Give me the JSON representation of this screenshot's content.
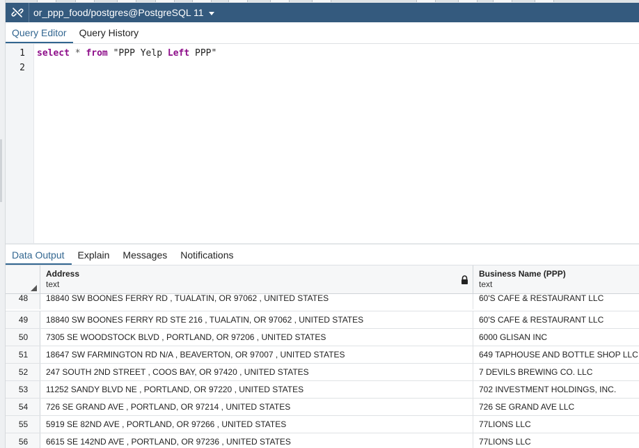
{
  "connection": {
    "label": "or_ppp_food/postgres@PostgreSQL 11"
  },
  "editor_tabs": [
    {
      "label": "Query Editor",
      "active": true
    },
    {
      "label": "Query History",
      "active": false
    }
  ],
  "editor": {
    "line_numbers": [
      "1",
      "2"
    ],
    "query": {
      "kw_select": "select",
      "star": "*",
      "kw_from": "from",
      "str_open": "\"PPP Yelp ",
      "kw_left": "Left",
      "str_close": " PPP\""
    }
  },
  "result_tabs": [
    {
      "label": "Data Output",
      "active": true
    },
    {
      "label": "Explain",
      "active": false
    },
    {
      "label": "Messages",
      "active": false
    },
    {
      "label": "Notifications",
      "active": false
    }
  ],
  "grid": {
    "columns": [
      {
        "name": "Address",
        "type": "text",
        "locked": true
      },
      {
        "name": "Business Name (PPP)",
        "type": "text",
        "locked": false
      }
    ],
    "rows": [
      {
        "n": "48",
        "address": "18840 SW BOONES FERRY RD , TUALATIN, OR 97062 ,  UNITED STATES",
        "business": "60'S CAFE & RESTAURANT LLC"
      },
      {
        "n": "49",
        "address": "18840 SW BOONES FERRY RD STE 216 , TUALATIN, OR 97062 ,  UNITED STATES",
        "business": "60'S CAFE & RESTAURANT LLC"
      },
      {
        "n": "50",
        "address": "7305 SE WOODSTOCK BLVD , PORTLAND, OR 97206 ,  UNITED STATES",
        "business": "6000 GLISAN INC"
      },
      {
        "n": "51",
        "address": "18647 SW FARMINGTON RD N/A , BEAVERTON, OR 97007 ,  UNITED STATES",
        "business": "649 TAPHOUSE AND BOTTLE SHOP LLC"
      },
      {
        "n": "52",
        "address": "247 SOUTH 2ND STREET , COOS BAY, OR 97420 ,  UNITED STATES",
        "business": "7 DEVILS BREWING CO. LLC"
      },
      {
        "n": "53",
        "address": "11252 SANDY BLVD NE , PORTLAND, OR 97220 ,  UNITED STATES",
        "business": "702 INVESTMENT HOLDINGS, INC."
      },
      {
        "n": "54",
        "address": "726 SE GRAND AVE , PORTLAND, OR 97214 ,  UNITED STATES",
        "business": "726 SE GRAND AVE LLC"
      },
      {
        "n": "55",
        "address": "5919 SE 82ND AVE , PORTLAND, OR 97266 ,  UNITED STATES",
        "business": "77LIONS LLC"
      },
      {
        "n": "56",
        "address": "6615 SE 142ND AVE , PORTLAND, OR 97236 ,  UNITED STATES",
        "business": "77LIONS LLC"
      }
    ]
  },
  "colors": {
    "connection_bar": "#345a7e",
    "active_tab": "#326690",
    "keyword": "#8e0e8a"
  }
}
